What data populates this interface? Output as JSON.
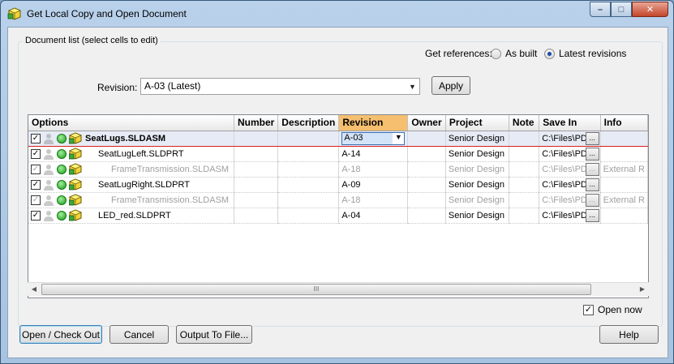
{
  "window": {
    "title": "Get Local Copy and Open Document",
    "min_glyph": "–",
    "max_glyph": "□",
    "close_glyph": "✕"
  },
  "group": {
    "label": "Document list (select cells to edit)"
  },
  "references": {
    "label": "Get references:",
    "option_as_built": "As built",
    "option_latest": "Latest revisions",
    "selected": "Latest revisions"
  },
  "revision": {
    "label": "Revision:",
    "value": "A-03 (Latest)",
    "apply_label": "Apply"
  },
  "grid": {
    "columns": [
      "Options",
      "Number",
      "Description",
      "Revision",
      "Owner",
      "Project",
      "Note",
      "Save In",
      "Info"
    ],
    "active_column": "Revision",
    "rows": [
      {
        "checked": true,
        "indent": 0,
        "name": "SeatLugs.SLDASM",
        "bold": true,
        "gray": false,
        "number": "",
        "description": "",
        "revision": "A-03",
        "owner": "",
        "project": "Senior Design",
        "note": "",
        "save_in": "C:\\Files\\PDM",
        "info": ""
      },
      {
        "checked": true,
        "indent": 1,
        "name": "SeatLugLeft.SLDPRT",
        "bold": false,
        "gray": false,
        "number": "",
        "description": "",
        "revision": "A-14",
        "owner": "",
        "project": "Senior Design",
        "note": "",
        "save_in": "C:\\Files\\PDM",
        "info": ""
      },
      {
        "checked": true,
        "indent": 2,
        "name": "FrameTransmission.SLDASM",
        "bold": false,
        "gray": true,
        "number": "",
        "description": "",
        "revision": "A-18",
        "owner": "",
        "project": "Senior Design",
        "note": "",
        "save_in": "C:\\Files\\PDM",
        "info": "External R"
      },
      {
        "checked": true,
        "indent": 1,
        "name": "SeatLugRight.SLDPRT",
        "bold": false,
        "gray": false,
        "number": "",
        "description": "",
        "revision": "A-09",
        "owner": "",
        "project": "Senior Design",
        "note": "",
        "save_in": "C:\\Files\\PDM",
        "info": ""
      },
      {
        "checked": true,
        "indent": 2,
        "name": "FrameTransmission.SLDASM",
        "bold": false,
        "gray": true,
        "number": "",
        "description": "",
        "revision": "A-18",
        "owner": "",
        "project": "Senior Design",
        "note": "",
        "save_in": "C:\\Files\\PDM",
        "info": "External R"
      },
      {
        "checked": true,
        "indent": 1,
        "name": "LED_red.SLDPRT",
        "bold": false,
        "gray": false,
        "number": "",
        "description": "",
        "revision": "A-04",
        "owner": "",
        "project": "Senior Design",
        "note": "",
        "save_in": "C:\\Files\\PDM",
        "info": ""
      }
    ],
    "scroll_grip": "III"
  },
  "footer": {
    "open_now_label": "Open now",
    "open_now_checked": true,
    "open_checkout_label": "Open / Check Out",
    "cancel_label": "Cancel",
    "output_label": "Output To File...",
    "help_label": "Help"
  }
}
